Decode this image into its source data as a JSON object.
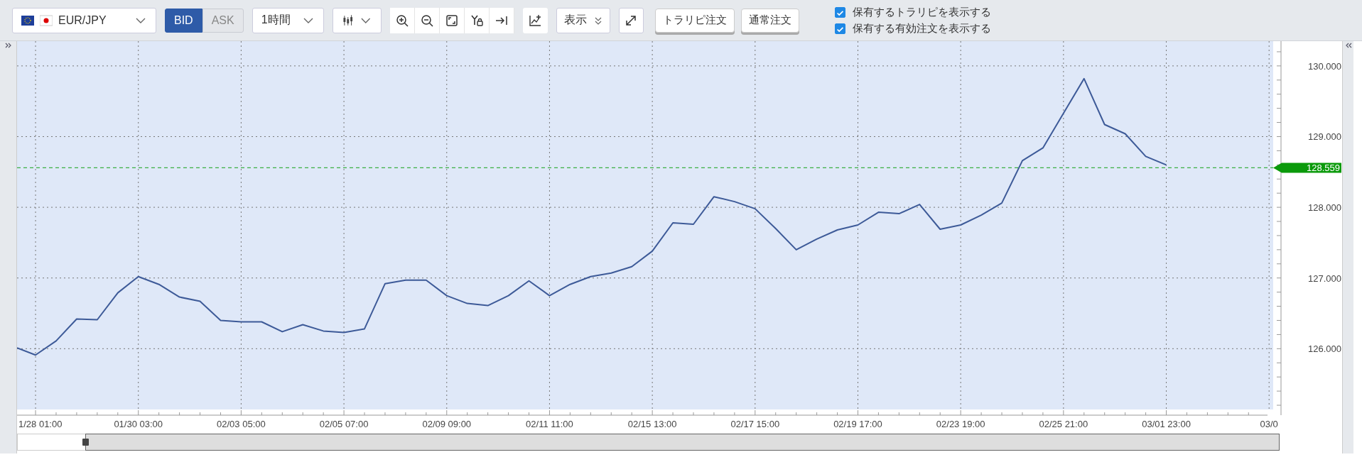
{
  "pair_selector": {
    "label": "EUR/JPY"
  },
  "price_type": [
    {
      "label": "BID",
      "selected": true
    },
    {
      "label": "ASK",
      "selected": false
    }
  ],
  "timeframe": {
    "label": "1時間"
  },
  "display_button": {
    "label": "表示"
  },
  "order_buttons": [
    "トラリピ注文",
    "通常注文"
  ],
  "options": [
    {
      "label": "保有するトラリピを表示する",
      "checked": true
    },
    {
      "label": "保有する有効注文を表示する",
      "checked": true
    }
  ],
  "chart": {
    "current_price": "128.559",
    "chart_data": {
      "type": "line",
      "ylim": [
        125.14,
        130.35
      ],
      "grid": true,
      "ref_lines": [
        {
          "axis": "y",
          "value": 128.559,
          "color": "#3cb043"
        }
      ],
      "categories": [
        null,
        "1/28 01:00",
        null,
        null,
        null,
        null,
        "01/30 03:00",
        null,
        null,
        null,
        null,
        "02/03 05:00",
        null,
        null,
        null,
        null,
        "02/05 07:00",
        null,
        null,
        null,
        null,
        "02/09 09:00",
        null,
        null,
        null,
        null,
        "02/11 11:00",
        null,
        null,
        null,
        null,
        "02/15 13:00",
        null,
        null,
        null,
        null,
        "02/17 15:00",
        null,
        null,
        null,
        null,
        "02/19 17:00",
        null,
        null,
        null,
        null,
        "02/23 19:00",
        null,
        null,
        null,
        null,
        "02/25 21:00",
        null,
        null,
        null,
        null,
        "03/01 23:00",
        null,
        null,
        null,
        null,
        "03/0"
      ],
      "series": [
        {
          "color": "#3d5a98",
          "values": [
            126.01,
            125.91,
            126.11,
            126.42,
            126.41,
            126.79,
            127.02,
            126.91,
            126.73,
            126.67,
            126.4,
            126.38,
            126.38,
            126.24,
            126.34,
            126.25,
            126.23,
            126.28,
            126.92,
            126.97,
            126.97,
            126.75,
            126.64,
            126.61,
            126.75,
            126.96,
            126.75,
            126.91,
            127.02,
            127.07,
            127.16,
            127.38,
            127.78,
            127.76,
            128.15,
            128.08,
            127.98,
            127.7,
            127.4,
            127.55,
            127.68,
            127.75,
            127.93,
            127.91,
            128.04,
            127.69,
            127.75,
            127.89,
            128.06,
            128.66,
            128.84,
            129.33,
            129.82,
            129.17,
            129.04,
            128.72,
            128.6,
            null,
            null,
            null,
            null,
            null
          ]
        }
      ],
      "yticks": [
        {
          "value": 126,
          "label": "126.000"
        },
        {
          "value": 127,
          "label": "127.000"
        },
        {
          "value": 128,
          "label": "128.000"
        },
        {
          "value": 129,
          "label": "129.000"
        },
        {
          "value": 130,
          "label": "130.000"
        }
      ]
    }
  }
}
